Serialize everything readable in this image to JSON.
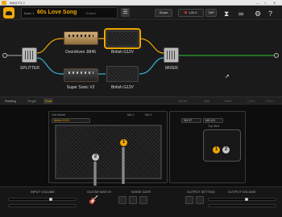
{
  "window": {
    "title": "BIAS FX 2",
    "controls": [
      "—",
      "□",
      "✕"
    ]
  },
  "header": {
    "bank": "Bank 1",
    "preset_name": "60s Love Song",
    "preset_tag": "*Edited",
    "save_label": "Share",
    "bpm_value": "120.0",
    "tap_label": "TAP"
  },
  "chain": {
    "splitter_label": "SPLITTER",
    "mixer_label": "MIXER",
    "top_amp_label": "Overdriven JM45",
    "top_cab_label": "British G12V",
    "bottom_amp_label": "Super Sonic V2",
    "bottom_cab_label": "British G12V"
  },
  "toolbar": {
    "routing_label": "Routing",
    "single_label": "Single",
    "dual_label": "Dual",
    "actions": [
      "Scene",
      "Add",
      "Clear",
      "Undo",
      "Redo"
    ]
  },
  "cab_panel": {
    "cab_label": "Cab Model",
    "cab_value": "British G12V",
    "mic1_label": "Mic 1",
    "mic2_label": "Mic 2",
    "marker_1": "1",
    "marker_2": "2",
    "mini_value_a": "SM 57",
    "mini_value_b": "MD 421",
    "mini_title": "Top View"
  },
  "bottom": {
    "input_label": "INPUT VOLUME",
    "guitar_match_label": "GUITAR MATCH",
    "noise_gate_label": "NOISE GATE",
    "output_setting_label": "OUTPUT SETTING",
    "output_volume_label": "OUTPUT VOLUME"
  },
  "colors": {
    "accent": "#f0a800",
    "panel": "#101010"
  }
}
